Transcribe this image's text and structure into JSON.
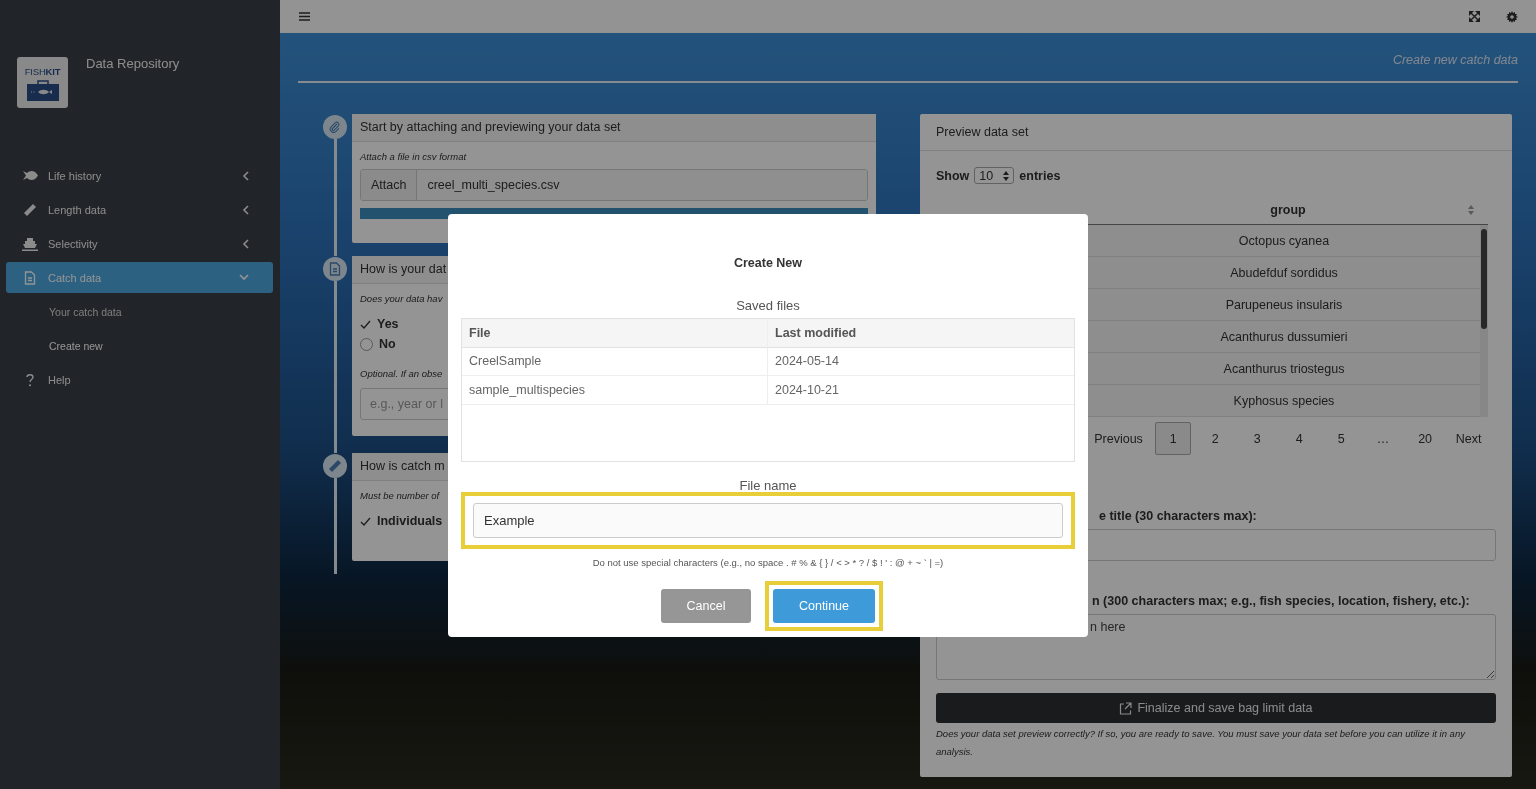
{
  "sidebar": {
    "logo": "FISH**KIT**",
    "title": "Data Repository",
    "items": [
      {
        "label": "Life history",
        "expanded": false,
        "selected": false
      },
      {
        "label": "Length data",
        "expanded": false,
        "selected": false
      },
      {
        "label": "Selectivity",
        "expanded": false,
        "selected": false
      },
      {
        "label": "Catch data",
        "expanded": true,
        "selected": true,
        "children": [
          {
            "label": "Your catch data",
            "selected": false
          },
          {
            "label": "Create new",
            "selected": true
          }
        ]
      },
      {
        "label": "Help",
        "selected": false
      }
    ]
  },
  "page_title": "Create new catch data",
  "steps": [
    {
      "kind": "upload",
      "title": "Start by attaching and previewing your data set",
      "hint": "Attach a file in csv format",
      "button": "Attach",
      "file": "creel_multi_species.csv",
      "level": 1
    },
    {
      "kind": "choice",
      "title": "How is your dat",
      "hint": "Does your data hav",
      "options": [
        {
          "label": "Yes",
          "selected": true
        },
        {
          "label": "No",
          "selected": false
        }
      ],
      "note": "Optional. If an obse",
      "placeholder": "e.g., year or l"
    },
    {
      "kind": "choice",
      "title": "How is catch m",
      "hint": "Must be number of",
      "options": [
        {
          "label": "Individuals",
          "selected": true
        }
      ]
    }
  ],
  "preview": {
    "title": "Preview data set",
    "show_label": "Show",
    "page_size": "10",
    "entries_label": "entries",
    "column": "group",
    "rows": [
      "Octopus cyanea",
      "Abudefduf sordidus",
      "Parupeneus insularis",
      "Acanthurus dussumieri",
      "Acanthurus triostegus",
      "Kyphosus species"
    ],
    "pagination": [
      {
        "label": "Previous",
        "selected": false
      },
      {
        "label": "1",
        "selected": true
      },
      {
        "label": "2",
        "selected": false
      },
      {
        "label": "3",
        "selected": false
      },
      {
        "label": "4",
        "selected": false
      },
      {
        "label": "5",
        "selected": false
      },
      {
        "label": "…",
        "selected": false
      },
      {
        "label": "20",
        "selected": false
      },
      {
        "label": "Next",
        "selected": false
      }
    ],
    "title_label": "e title (30 characters max):",
    "description_label": "n (300 characters max; e.g., fish species, location, fishery, etc.):",
    "description_placeholder": "n here",
    "save_button": "Finalize and save bag limit data",
    "note": "Does your data set preview correctly? If so, you are ready to save. You must save your data set before you can utilize it in any analysis."
  },
  "modal": {
    "title": "Create New",
    "saved_files_label": "Saved files",
    "columns": [
      "File",
      "Last modified"
    ],
    "rows": [
      [
        "CreelSample",
        "2024-05-14"
      ],
      [
        "sample_multispecies",
        "2024-10-21"
      ]
    ],
    "file_name_label": "File name",
    "file_name": {
      "value": "Example",
      "highlighted": true
    },
    "hint": "Do not use special characters (e.g., no space . # % & { } / < > * ? / $ ! ' : @ + ~ ` | =)",
    "buttons": [
      {
        "label": "Cancel",
        "kind": "secondary",
        "highlighted": false
      },
      {
        "label": "Continue",
        "kind": "primary",
        "highlighted": true
      }
    ]
  }
}
